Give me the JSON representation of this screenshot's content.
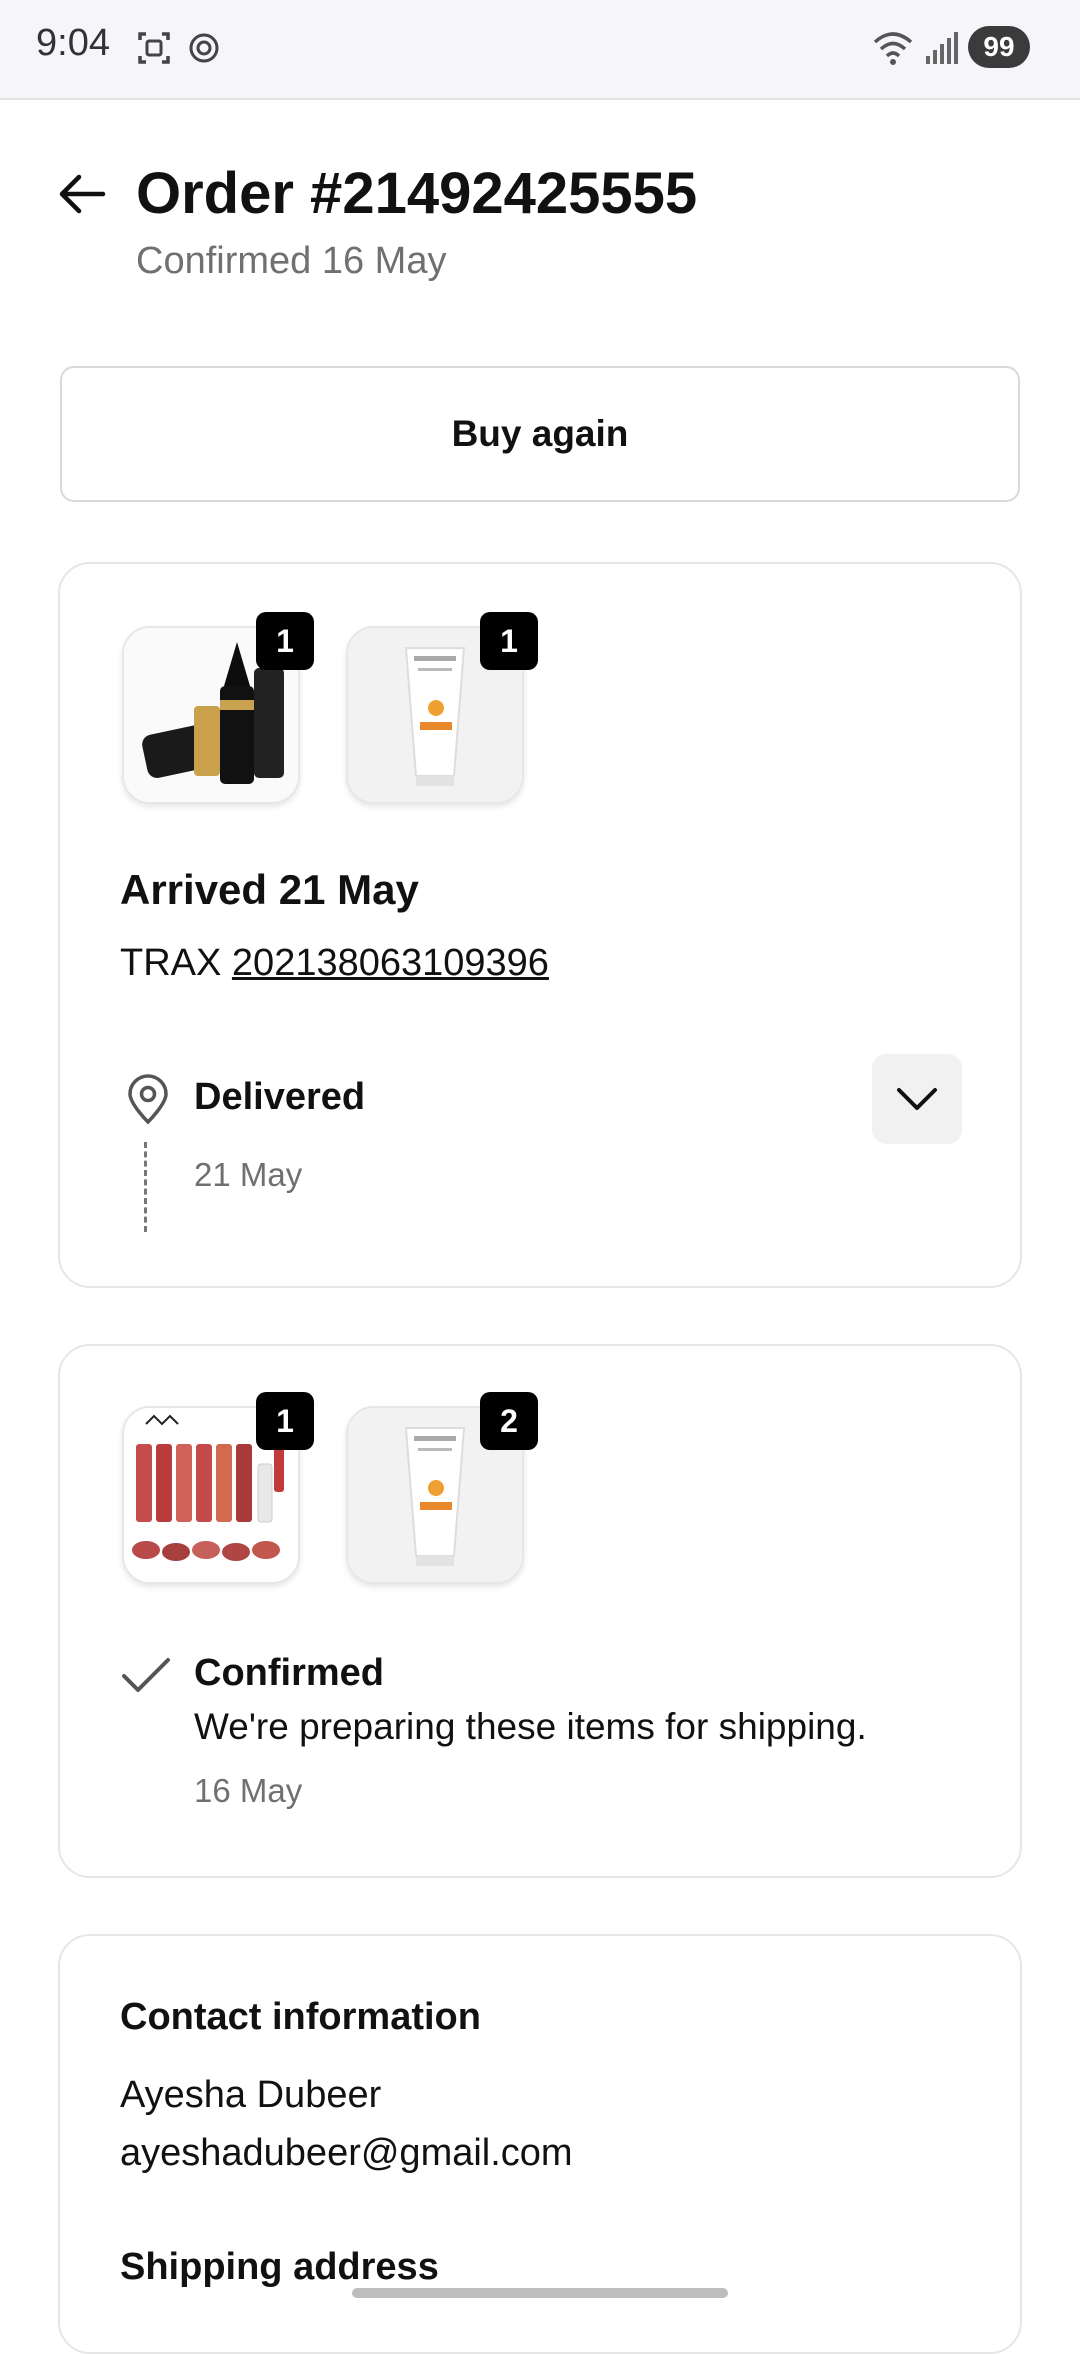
{
  "status_bar": {
    "time": "9:04",
    "battery": "99",
    "icons": [
      "screenshot-icon",
      "openai-icon",
      "wifi-icon",
      "signal-icon"
    ]
  },
  "header": {
    "title": "Order #21492425555",
    "subtitle": "Confirmed 16 May",
    "back_icon": "arrow-left-icon"
  },
  "buy_again_label": "Buy again",
  "shipment_1": {
    "items": [
      {
        "name": "kajal-eyeliner",
        "qty": "1"
      },
      {
        "name": "vince-sun-block",
        "qty": "1"
      }
    ],
    "arrival": "Arrived 21 May",
    "carrier": "TRAX",
    "tracking_number": "202138063109396",
    "status": "Delivered",
    "status_date": "21 May"
  },
  "shipment_2": {
    "items": [
      {
        "name": "lip-gloss-set",
        "qty": "1"
      },
      {
        "name": "vince-sun-block",
        "qty": "2"
      }
    ],
    "status": "Confirmed",
    "message": "We're preparing these items for shipping.",
    "status_date": "16 May"
  },
  "contact": {
    "title": "Contact information",
    "name": "Ayesha Dubeer",
    "email": "ayeshadubeer@gmail.com"
  },
  "shipping": {
    "title": "Shipping address"
  },
  "colors": {
    "badge": "#000000",
    "muted_text": "#707070",
    "border": "#e6e6e6"
  }
}
